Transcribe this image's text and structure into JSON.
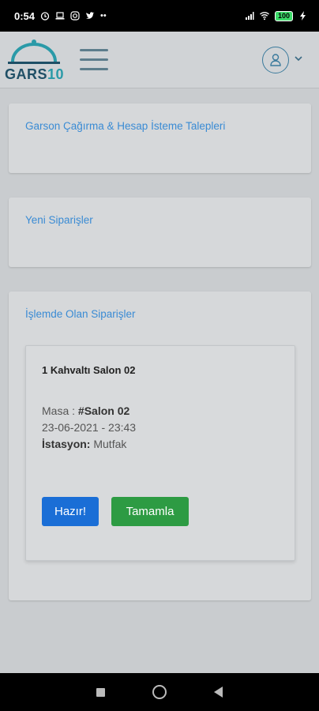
{
  "status_bar": {
    "time": "0:54",
    "battery": "100"
  },
  "header": {
    "logo_text_main": "GARS",
    "logo_text_accent": "10",
    "brand_color": "#2a9aa8"
  },
  "panels": {
    "calls_title": "Garson Çağırma & Hesap İsteme Talepleri",
    "new_orders_title": "Yeni Siparişler",
    "in_progress_title": "İşlemde Olan Siparişler"
  },
  "order": {
    "title": "1 Kahvaltı Salon 02",
    "table_label": "Masa :",
    "table_value": "#Salon 02",
    "datetime": "23-06-2021 - 23:43",
    "station_label": "İstasyon:",
    "station_value": "Mutfak",
    "ready_button": "Hazır!",
    "complete_button": "Tamamla"
  },
  "colors": {
    "link": "#3a8bd4",
    "ready": "#1a6ed6",
    "complete": "#2d9b43"
  }
}
